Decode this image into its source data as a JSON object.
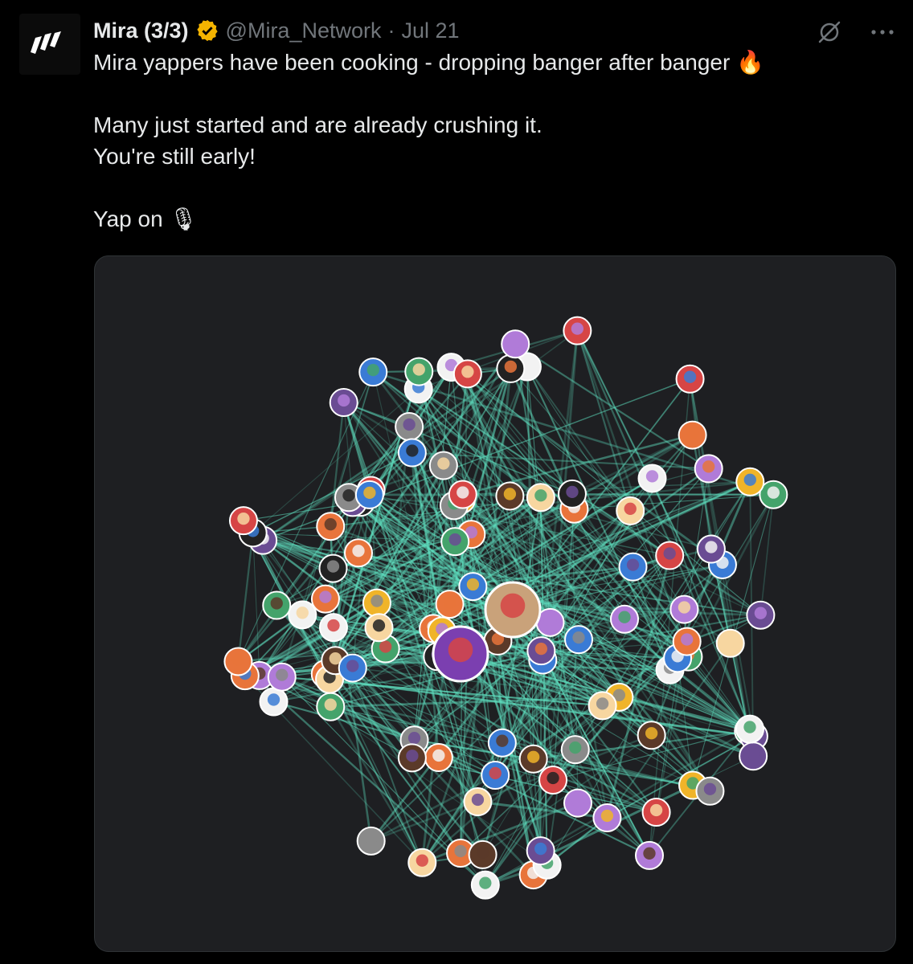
{
  "tweet": {
    "author_name": "Mira (3/3)",
    "handle": "@Mira_Network",
    "separator": "·",
    "date": "Jul 21",
    "lines": [
      "Mira yappers have been cooking - dropping banger after banger 🔥",
      "",
      "Many just started and are already crushing it.",
      "You're still early!",
      "",
      "Yap on 🎙"
    ]
  },
  "icons": {
    "avatar": "mira-logo-icon",
    "verified": "verified-badge-icon",
    "grok": "grok-icon",
    "more": "more-options-icon"
  },
  "colors": {
    "background": "#000000",
    "text": "#e7e9ea",
    "muted": "#71767b",
    "verified": "#f4b400",
    "media_bg": "#1e1f22",
    "network_edges": "#5fe0c0"
  },
  "media": {
    "type": "network-graph",
    "node_count": 110,
    "hub_count": 2
  }
}
